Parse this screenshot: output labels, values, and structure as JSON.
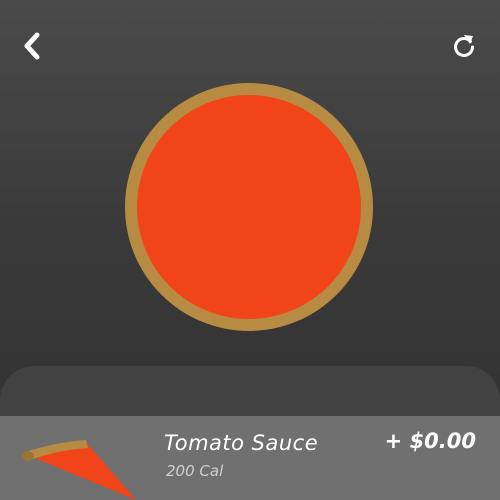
{
  "header": {
    "back_icon": "chevron-left-icon",
    "reset_icon": "rotate-right-icon"
  },
  "preview": {
    "crust_color": "#b78c42",
    "sauce_color": "#f24419"
  },
  "topping_item": {
    "name": "Tomato Sauce",
    "price": "+ $0.00",
    "calories": "200 Cal",
    "thumb_icon": "sauce-slice-icon"
  }
}
